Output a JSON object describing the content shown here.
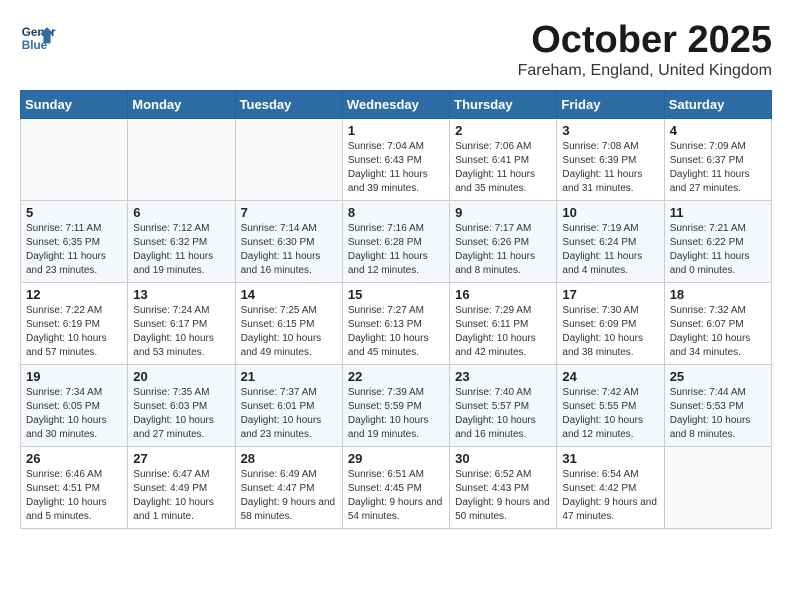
{
  "header": {
    "logo_line1": "General",
    "logo_line2": "Blue",
    "month_title": "October 2025",
    "location": "Fareham, England, United Kingdom"
  },
  "weekdays": [
    "Sunday",
    "Monday",
    "Tuesday",
    "Wednesday",
    "Thursday",
    "Friday",
    "Saturday"
  ],
  "weeks": [
    [
      {
        "day": "",
        "info": ""
      },
      {
        "day": "",
        "info": ""
      },
      {
        "day": "",
        "info": ""
      },
      {
        "day": "1",
        "info": "Sunrise: 7:04 AM\nSunset: 6:43 PM\nDaylight: 11 hours\nand 39 minutes."
      },
      {
        "day": "2",
        "info": "Sunrise: 7:06 AM\nSunset: 6:41 PM\nDaylight: 11 hours\nand 35 minutes."
      },
      {
        "day": "3",
        "info": "Sunrise: 7:08 AM\nSunset: 6:39 PM\nDaylight: 11 hours\nand 31 minutes."
      },
      {
        "day": "4",
        "info": "Sunrise: 7:09 AM\nSunset: 6:37 PM\nDaylight: 11 hours\nand 27 minutes."
      }
    ],
    [
      {
        "day": "5",
        "info": "Sunrise: 7:11 AM\nSunset: 6:35 PM\nDaylight: 11 hours\nand 23 minutes."
      },
      {
        "day": "6",
        "info": "Sunrise: 7:12 AM\nSunset: 6:32 PM\nDaylight: 11 hours\nand 19 minutes."
      },
      {
        "day": "7",
        "info": "Sunrise: 7:14 AM\nSunset: 6:30 PM\nDaylight: 11 hours\nand 16 minutes."
      },
      {
        "day": "8",
        "info": "Sunrise: 7:16 AM\nSunset: 6:28 PM\nDaylight: 11 hours\nand 12 minutes."
      },
      {
        "day": "9",
        "info": "Sunrise: 7:17 AM\nSunset: 6:26 PM\nDaylight: 11 hours\nand 8 minutes."
      },
      {
        "day": "10",
        "info": "Sunrise: 7:19 AM\nSunset: 6:24 PM\nDaylight: 11 hours\nand 4 minutes."
      },
      {
        "day": "11",
        "info": "Sunrise: 7:21 AM\nSunset: 6:22 PM\nDaylight: 11 hours\nand 0 minutes."
      }
    ],
    [
      {
        "day": "12",
        "info": "Sunrise: 7:22 AM\nSunset: 6:19 PM\nDaylight: 10 hours\nand 57 minutes."
      },
      {
        "day": "13",
        "info": "Sunrise: 7:24 AM\nSunset: 6:17 PM\nDaylight: 10 hours\nand 53 minutes."
      },
      {
        "day": "14",
        "info": "Sunrise: 7:25 AM\nSunset: 6:15 PM\nDaylight: 10 hours\nand 49 minutes."
      },
      {
        "day": "15",
        "info": "Sunrise: 7:27 AM\nSunset: 6:13 PM\nDaylight: 10 hours\nand 45 minutes."
      },
      {
        "day": "16",
        "info": "Sunrise: 7:29 AM\nSunset: 6:11 PM\nDaylight: 10 hours\nand 42 minutes."
      },
      {
        "day": "17",
        "info": "Sunrise: 7:30 AM\nSunset: 6:09 PM\nDaylight: 10 hours\nand 38 minutes."
      },
      {
        "day": "18",
        "info": "Sunrise: 7:32 AM\nSunset: 6:07 PM\nDaylight: 10 hours\nand 34 minutes."
      }
    ],
    [
      {
        "day": "19",
        "info": "Sunrise: 7:34 AM\nSunset: 6:05 PM\nDaylight: 10 hours\nand 30 minutes."
      },
      {
        "day": "20",
        "info": "Sunrise: 7:35 AM\nSunset: 6:03 PM\nDaylight: 10 hours\nand 27 minutes."
      },
      {
        "day": "21",
        "info": "Sunrise: 7:37 AM\nSunset: 6:01 PM\nDaylight: 10 hours\nand 23 minutes."
      },
      {
        "day": "22",
        "info": "Sunrise: 7:39 AM\nSunset: 5:59 PM\nDaylight: 10 hours\nand 19 minutes."
      },
      {
        "day": "23",
        "info": "Sunrise: 7:40 AM\nSunset: 5:57 PM\nDaylight: 10 hours\nand 16 minutes."
      },
      {
        "day": "24",
        "info": "Sunrise: 7:42 AM\nSunset: 5:55 PM\nDaylight: 10 hours\nand 12 minutes."
      },
      {
        "day": "25",
        "info": "Sunrise: 7:44 AM\nSunset: 5:53 PM\nDaylight: 10 hours\nand 8 minutes."
      }
    ],
    [
      {
        "day": "26",
        "info": "Sunrise: 6:46 AM\nSunset: 4:51 PM\nDaylight: 10 hours\nand 5 minutes."
      },
      {
        "day": "27",
        "info": "Sunrise: 6:47 AM\nSunset: 4:49 PM\nDaylight: 10 hours\nand 1 minute."
      },
      {
        "day": "28",
        "info": "Sunrise: 6:49 AM\nSunset: 4:47 PM\nDaylight: 9 hours\nand 58 minutes."
      },
      {
        "day": "29",
        "info": "Sunrise: 6:51 AM\nSunset: 4:45 PM\nDaylight: 9 hours\nand 54 minutes."
      },
      {
        "day": "30",
        "info": "Sunrise: 6:52 AM\nSunset: 4:43 PM\nDaylight: 9 hours\nand 50 minutes."
      },
      {
        "day": "31",
        "info": "Sunrise: 6:54 AM\nSunset: 4:42 PM\nDaylight: 9 hours\nand 47 minutes."
      },
      {
        "day": "",
        "info": ""
      }
    ]
  ]
}
